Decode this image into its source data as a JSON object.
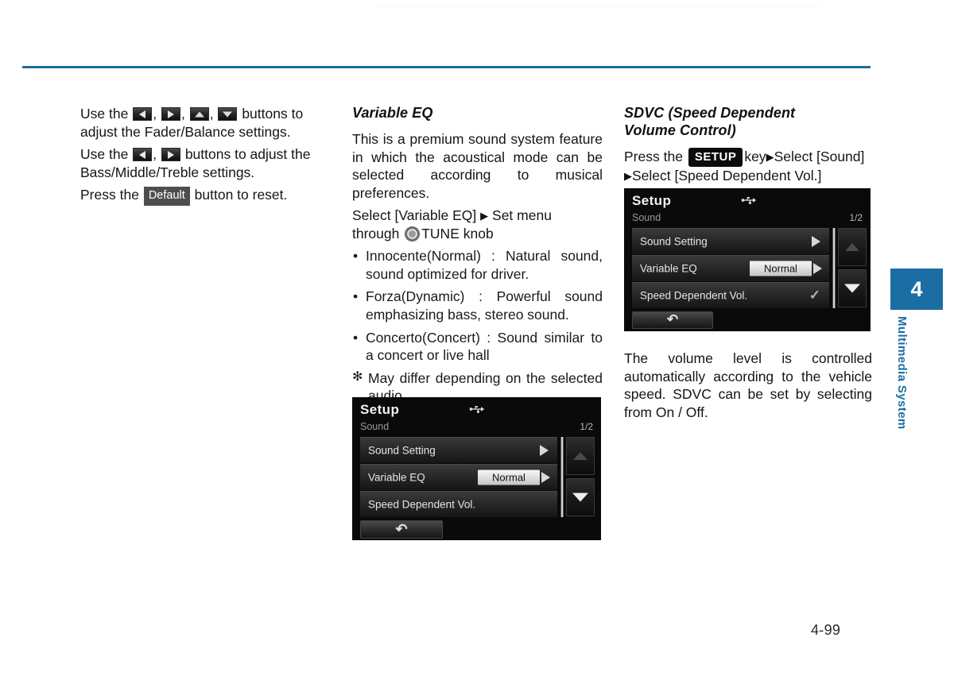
{
  "page": {
    "folio": "4-99",
    "rule_color": "#1b6ea4"
  },
  "chapter_tab": {
    "number": "4",
    "name": "Multimedia System",
    "color": "#1b6ea4"
  },
  "left_column": {
    "para1_part1": "Use the",
    "para1_sep1": ",",
    "para1_sep2": ",",
    "para1_sep3": ",",
    "para1_part2": "buttons to adjust the Fader/Balance settings.",
    "para2_part1": "Use the",
    "para2_sep1": ",",
    "para2_part2": "buttons to adjust the Bass/Middle/Treble settings.",
    "para3_part1": "Press the",
    "para3_button": "Default",
    "para3_part2": "button to reset.",
    "keys": [
      {
        "name": "left-arrow-key",
        "dir": "left"
      },
      {
        "name": "right-arrow-key",
        "dir": "right"
      },
      {
        "name": "up-arrow-key",
        "dir": "up"
      },
      {
        "name": "down-arrow-key",
        "dir": "down"
      }
    ]
  },
  "middle_column": {
    "heading": "Variable EQ",
    "intro": "This is a premium sound system feature in which the acoustical mode can be selected according to musical preferences.",
    "select_line_part1": "Select [Variable EQ]",
    "select_arrow": "▶",
    "select_line_part2": "Set menu through",
    "knob_label": "TUNE knob",
    "bullets": [
      {
        "mark": "•",
        "text": "Innocente(Normal) : Natural sound, sound optimized for driver."
      },
      {
        "mark": "•",
        "text": "Forza(Dynamic) : Powerful sound emphasizing bass, stereo sound."
      },
      {
        "mark": "•",
        "text": "Concerto(Concert) : Sound similar to a concert or live hall"
      },
      {
        "mark": "✻",
        "text": "May differ depending on the selected audio.",
        "note": true
      }
    ]
  },
  "right_column": {
    "heading_line1": "SDVC (Speed Dependent",
    "heading_line2": "Volume Control)",
    "press_part1": "Press the",
    "setup_key": "SETUP",
    "press_part2": "key",
    "arrow1": "▶",
    "press_part3": "Select [Sound]",
    "arrow2": "▶",
    "press_part4": "Select [Speed Dependent Vol.]",
    "body": "The volume level is controlled automatically according to the vehicle speed. SDVC can be set by selecting from On / Off."
  },
  "screenshot_small": {
    "title": "Setup",
    "usb_icon": "usb-icon",
    "subtitle": "Sound",
    "page_indicator": "1/2",
    "rows": [
      {
        "label": "Sound Setting",
        "type": "arrow"
      },
      {
        "label": "Variable EQ",
        "type": "value-arrow",
        "value": "Normal"
      },
      {
        "label": "Speed Dependent Vol.",
        "type": "check",
        "check": "✓"
      }
    ],
    "back_glyph": "↶",
    "scroll_up": "scroll-up-button",
    "scroll_down": "scroll-down-button"
  },
  "screenshot_large": {
    "title": "Setup",
    "usb_icon": "usb-icon",
    "subtitle": "Sound",
    "page_indicator": "1/2",
    "rows": [
      {
        "label": "Sound Setting",
        "type": "arrow"
      },
      {
        "label": "Variable EQ",
        "type": "value-arrow",
        "value": "Normal"
      },
      {
        "label": "Speed Dependent Vol.",
        "type": "plain"
      }
    ],
    "back_glyph": "↶",
    "scroll_up": "scroll-up-button",
    "scroll_down": "scroll-down-button"
  }
}
